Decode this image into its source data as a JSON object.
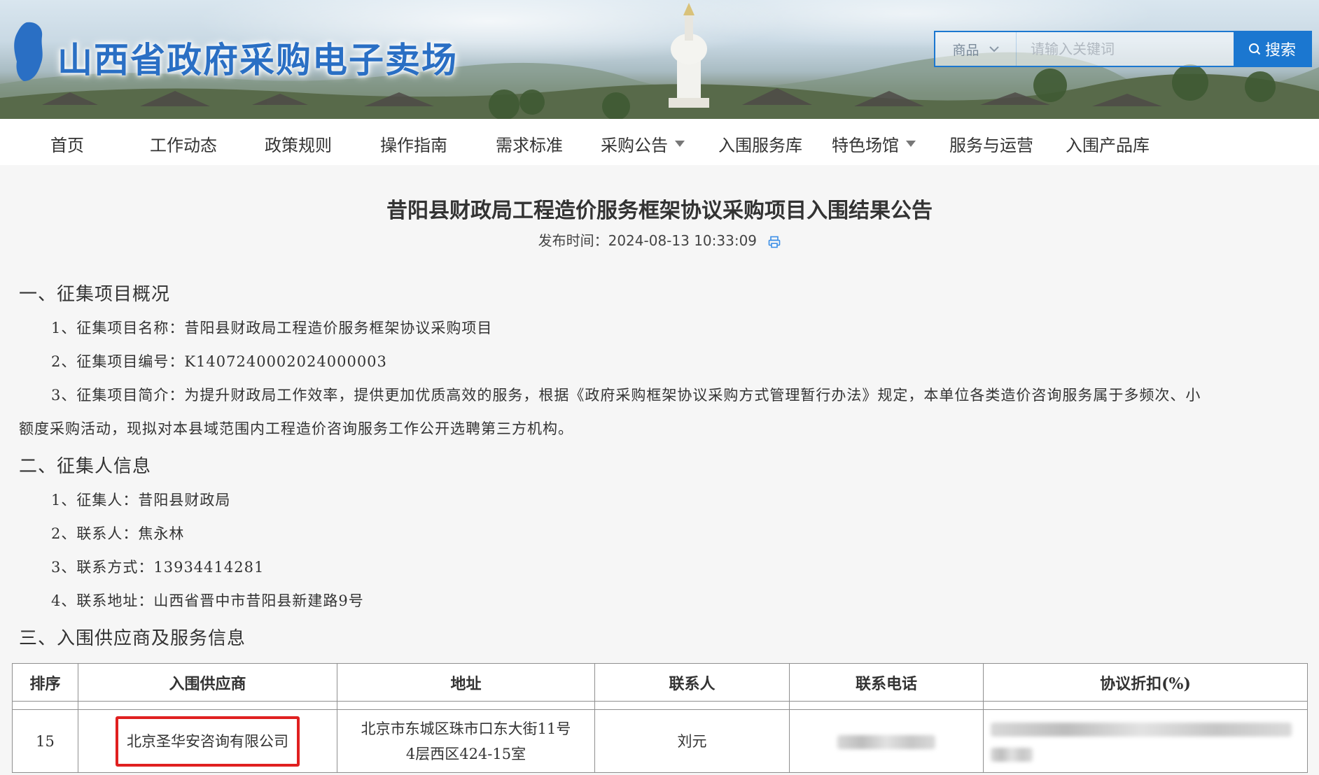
{
  "header": {
    "site_title": "山西省政府采购电子卖场",
    "search": {
      "category": "商品",
      "placeholder": "请输入关键词",
      "button_label": "搜索"
    }
  },
  "nav": {
    "items": [
      {
        "label": "首页",
        "has_dropdown": false
      },
      {
        "label": "工作动态",
        "has_dropdown": false
      },
      {
        "label": "政策规则",
        "has_dropdown": false
      },
      {
        "label": "操作指南",
        "has_dropdown": false
      },
      {
        "label": "需求标准",
        "has_dropdown": false
      },
      {
        "label": "采购公告",
        "has_dropdown": true
      },
      {
        "label": "入围服务库",
        "has_dropdown": false
      },
      {
        "label": "特色场馆",
        "has_dropdown": true
      },
      {
        "label": "服务与运营",
        "has_dropdown": false
      },
      {
        "label": "入围产品库",
        "has_dropdown": false
      }
    ]
  },
  "article": {
    "title": "昔阳县财政局工程造价服务框架协议采购项目入围结果公告",
    "publish_label": "发布时间：",
    "publish_time": "2024-08-13 10:33:09",
    "sections": [
      {
        "heading": "一、征集项目概况",
        "lines": [
          "1、征集项目名称：昔阳县财政局工程造价服务框架协议采购项目",
          "2、征集项目编号：K1407240002024000003",
          "3、征集项目简介：为提升财政局工作效率，提供更加优质高效的服务，根据《政府采购框架协议采购方式管理暂行办法》规定，本单位各类造价咨询服务属于多频次、小",
          "额度采购活动，现拟对本县域范围内工程造价咨询服务工作公开选聘第三方机构。"
        ]
      },
      {
        "heading": "二、征集人信息",
        "lines": [
          "1、征集人：昔阳县财政局",
          "2、联系人：焦永林",
          "3、联系方式：13934414281",
          "4、联系地址：山西省晋中市昔阳县新建路9号"
        ]
      },
      {
        "heading": "三、入围供应商及服务信息",
        "lines": []
      }
    ],
    "table": {
      "headers": [
        "排序",
        "入围供应商",
        "地址",
        "联系人",
        "联系电话",
        "协议折扣(%)"
      ],
      "rows": [
        {
          "rank": "15",
          "supplier": "北京圣华安咨询有限公司",
          "address_line1": "北京市东城区珠市口东大街11号",
          "address_line2": "4层西区424-15室",
          "contact": "刘元"
        }
      ]
    }
  },
  "colors": {
    "brand_blue": "#1b77d0",
    "title_blue": "#2a6fc4",
    "highlight_red": "#e02020"
  }
}
